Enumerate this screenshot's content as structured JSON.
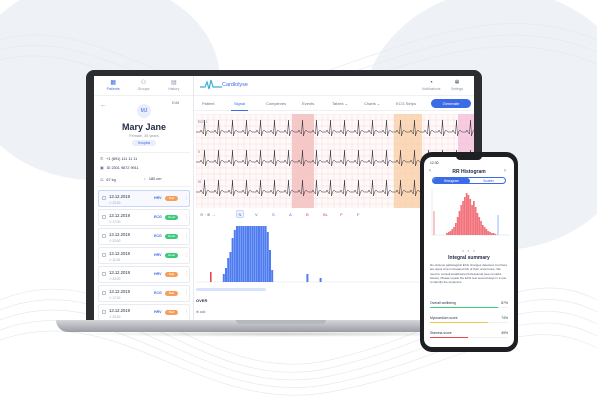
{
  "rail": {
    "nav": [
      {
        "label": "Patients",
        "icon": "patients-icon",
        "glyph": "▦"
      },
      {
        "label": "Groups",
        "icon": "groups-icon",
        "glyph": "⚇"
      },
      {
        "label": "History",
        "icon": "history-icon",
        "glyph": "▤"
      }
    ],
    "patient": {
      "initials": "MJ",
      "name": "Mary Jane",
      "sub": "Female, 35 years",
      "badge": "Hospital",
      "phone": "+1 (891) 111 11 11",
      "id": "ID 2301 9872 9911",
      "weight": "67 kg",
      "height": "180 cm"
    },
    "records": [
      {
        "date": "13.12.2019",
        "time": "⏱ 23:00",
        "type": "HRV",
        "badge": "Bad",
        "color": "#f5a05a",
        "selected": true
      },
      {
        "date": "13.12.2019",
        "time": "⏱ 17:00",
        "type": "ECG",
        "badge": "Good",
        "color": "#3cc97a",
        "selected": false
      },
      {
        "date": "13.12.2019",
        "time": "⏱ 23:00",
        "type": "ECG",
        "badge": "Good",
        "color": "#3cc97a",
        "selected": false
      },
      {
        "date": "13.12.2019",
        "time": "⏱ 11:00",
        "type": "HRV",
        "badge": "Good",
        "color": "#3cc97a",
        "selected": false
      },
      {
        "date": "13.12.2019",
        "time": "⏱ 23:00",
        "type": "HRV",
        "badge": "Bad",
        "color": "#f5a05a",
        "selected": false
      },
      {
        "date": "13.12.2019",
        "time": "⏱ 17:00",
        "type": "ECG",
        "badge": "Bad",
        "color": "#f5a05a",
        "selected": false
      },
      {
        "date": "13.12.2019",
        "time": "⏱ 23:00",
        "type": "HRV",
        "badge": "Bad",
        "color": "#f5a05a",
        "selected": false
      }
    ]
  },
  "topbar": {
    "brand": "Cardiolyse",
    "right": [
      {
        "label": "Notifications",
        "icon": "bell-icon",
        "glyph": "◔"
      },
      {
        "label": "Settings",
        "icon": "gear-icon",
        "glyph": "✲"
      }
    ],
    "edit": "Edit"
  },
  "tabs": [
    "Patient",
    "Signal",
    "Complexes",
    "Events",
    "Tables ⌄",
    "Charts ⌄",
    "ECG Strips"
  ],
  "active_tab": 1,
  "generate_label": "Generate",
  "ecg": {
    "lead_labels": [
      "ECG I",
      "II",
      "III"
    ],
    "colors": {
      "grid": "#f1c6c6",
      "wave": "#2b2d38",
      "red_zone": "#f6c8c8",
      "orange_zone": "#fbd9b6",
      "pink_zone": "#f7cbe2"
    }
  },
  "controls": {
    "zoom": "⊖ · ⊕ →",
    "labels": [
      "N",
      "V",
      "S",
      "A",
      "B",
      "BL",
      "P",
      "F"
    ],
    "active": 0
  },
  "footer": {
    "title": "OVER",
    "sub": "⊕ add"
  },
  "phone": {
    "status": "12:30",
    "title": "RR Histogram",
    "toggle": [
      "Histogram",
      "Scatter"
    ],
    "summary_title": "Integral summary",
    "summary_text": "No obvious pathological ECG changes detected, but there are signs of an increased risk of their occurrence. We need to consult Healthcare Professional (see remarks below). Please repeat the ECG test several days in a row to identify the dynamics.",
    "scores": [
      {
        "name": "Overall wellbeing",
        "value": "87%",
        "color": "#3cc97a",
        "fraction": 0.87
      },
      {
        "name": "Myocardium score",
        "value": "74%",
        "color": "#f0c64a",
        "fraction": 0.74
      },
      {
        "name": "Stamina score",
        "value": "49%",
        "color": "#e5484d",
        "fraction": 0.49
      }
    ],
    "accent": "#f2737c"
  }
}
